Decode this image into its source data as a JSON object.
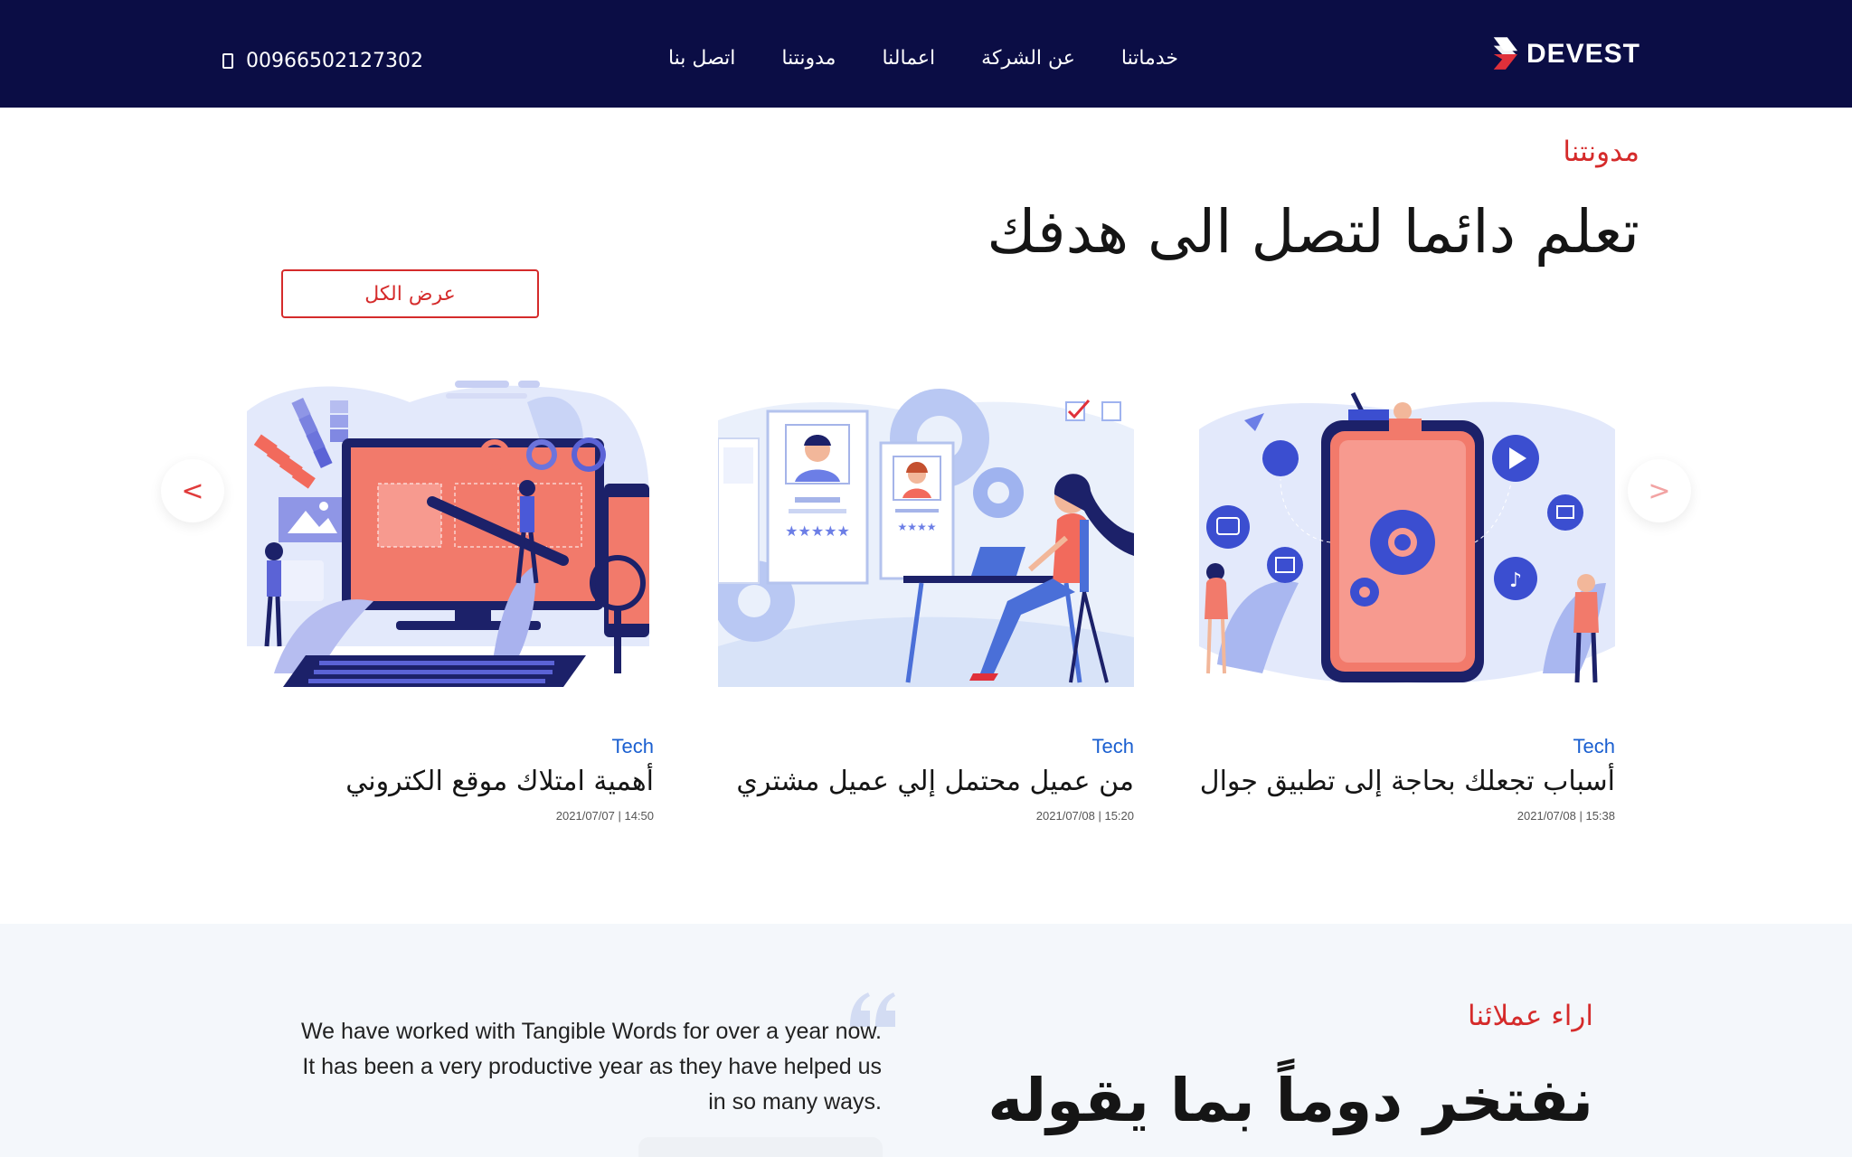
{
  "header": {
    "logo_text": "DEVEST",
    "nav": [
      "خدماتنا",
      "عن الشركة",
      "اعمالنا",
      "مدونتنا",
      "اتصل بنا"
    ],
    "phone": "00966502127302"
  },
  "blog": {
    "eyebrow": "مدونتنا",
    "title": "تعلم دائما لتصل الى هدفك",
    "view_all": "عرض الكل",
    "prev_arrow": "<",
    "next_arrow": ">",
    "cards": [
      {
        "tag": "Tech",
        "title": "أسباب تجعلك بحاجة إلى تطبيق جوال",
        "date": "2021/07/08 | 15:38",
        "illustration": "mobile-app-illustration"
      },
      {
        "tag": "Tech",
        "title": "من عميل محتمل إلي عميل مشتري",
        "date": "2021/07/08 | 15:20",
        "illustration": "customer-profiles-illustration"
      },
      {
        "tag": "Tech",
        "title": "أهمية امتلاك موقع الكتروني",
        "date": "2021/07/07 | 14:50",
        "illustration": "web-design-illustration"
      }
    ]
  },
  "testimonials": {
    "eyebrow": "اراء عملائنا",
    "title": "نفتخر دوماً بما يقوله",
    "quote": "We have worked with Tangible Words for over a year now. It has been a very productive year as they have helped us in so many ways."
  },
  "colors": {
    "header_bg": "#0b0d45",
    "accent_red": "#d52b2b",
    "tag_blue": "#1a5fd0",
    "section_bg": "#f4f7fb"
  }
}
